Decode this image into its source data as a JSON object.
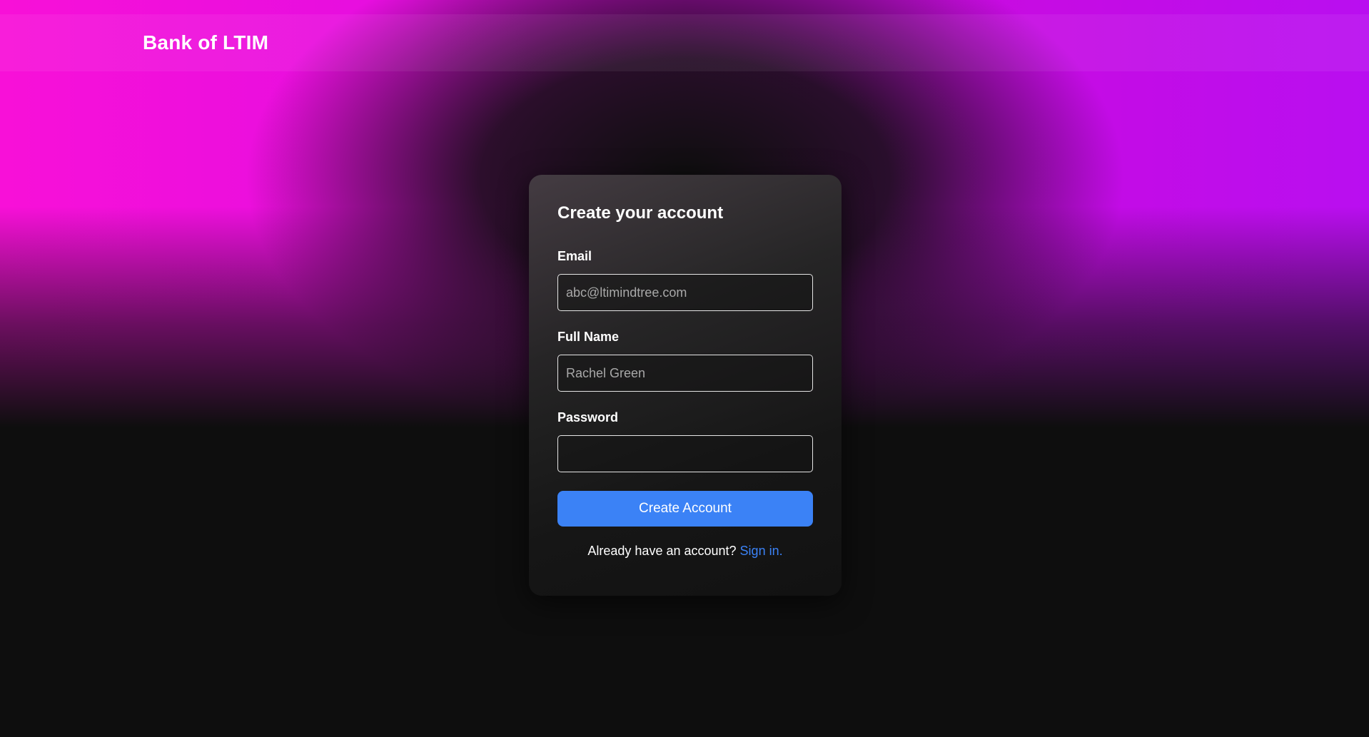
{
  "header": {
    "brand": "Bank of LTIM"
  },
  "form": {
    "title": "Create your account",
    "email": {
      "label": "Email",
      "placeholder": "abc@ltimindtree.com",
      "value": ""
    },
    "full_name": {
      "label": "Full Name",
      "placeholder": "Rachel Green",
      "value": ""
    },
    "password": {
      "label": "Password",
      "placeholder": "",
      "value": ""
    },
    "submit_label": "Create Account",
    "signin_prompt": "Already have an account?",
    "signin_link": "Sign in."
  },
  "colors": {
    "accent": "#3b82f6",
    "background": "#0e0e0e",
    "gradient_pink": "#f810d8",
    "gradient_purple": "#b90ef0"
  }
}
